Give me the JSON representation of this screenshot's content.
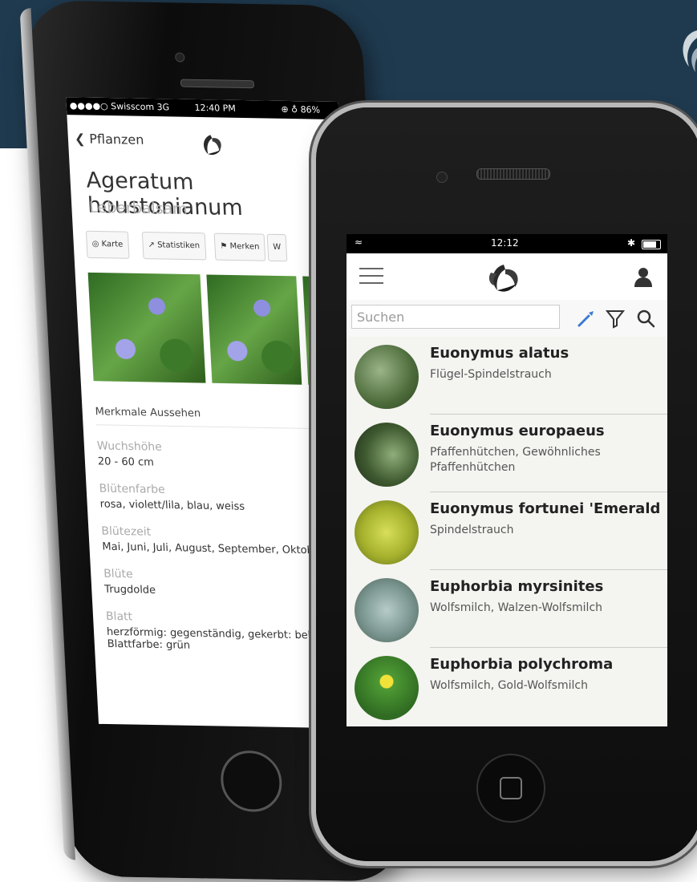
{
  "back_phone": {
    "status": {
      "carrier": "●●●●○ Swisscom  3G",
      "time": "12:40 PM",
      "battery": "⊕ ♁ 86%"
    },
    "nav_back": "Pflanzen",
    "title": "Ageratum houstonianum",
    "subtitle": "Leberbalsam",
    "tabs": [
      "Karte",
      "Statistiken",
      "Merken",
      "W"
    ],
    "properties_header": "Merkmale Aussehen",
    "properties": [
      {
        "label": "Wuchshöhe",
        "value": "20 - 60 cm"
      },
      {
        "label": "Blütenfarbe",
        "value": "rosa, violett/lila, blau, weiss"
      },
      {
        "label": "Blütezeit",
        "value": "Mai, Juni, Juli, August, September, Oktober"
      },
      {
        "label": "Blüte",
        "value": "Trugdolde"
      },
      {
        "label": "Blatt",
        "value": "herzförmig: gegenständig, gekerbt: behaart, Blattfarbe: grün"
      }
    ]
  },
  "front_phone": {
    "status": {
      "time": "12:12"
    },
    "search": {
      "placeholder": "Suchen"
    },
    "plants": [
      {
        "name": "Euonymus alatus",
        "common": "Flügel-Spindelstrauch",
        "color": "#6e8f5a"
      },
      {
        "name": "Euonymus europaeus",
        "common": "Pfaffenhütchen, Gewöhnliches Pfaffenhütchen",
        "color": "#4f6a3e"
      },
      {
        "name": "Euonymus fortunei 'Emerald",
        "common": "Spindelstrauch",
        "color": "#b7c23a"
      },
      {
        "name": "Euphorbia myrsinites",
        "common": "Wolfsmilch, Walzen-Wolfsmilch",
        "color": "#8fa7a4"
      },
      {
        "name": "Euphorbia polychroma",
        "common": "Wolfsmilch, Gold-Wolfsmilch",
        "color": "#3f7a2c"
      }
    ]
  },
  "colors": {
    "banner": "#1f3a4f",
    "accent": "#3a7bd5"
  }
}
